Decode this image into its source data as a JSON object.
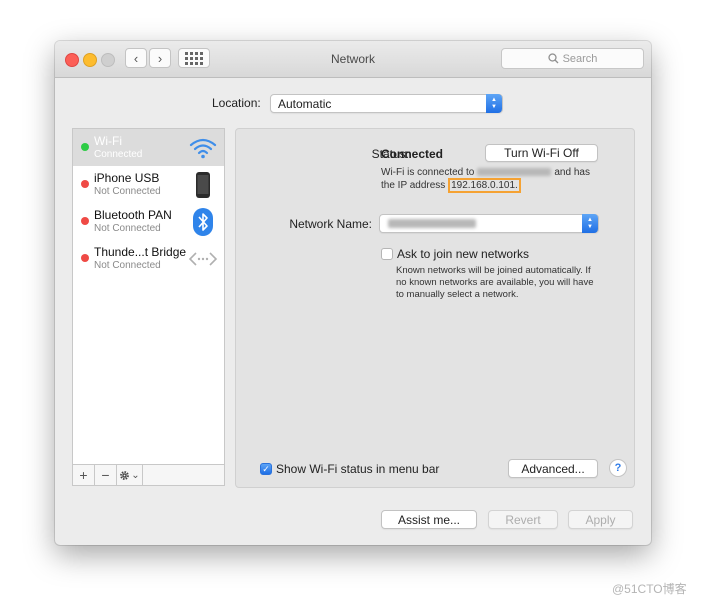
{
  "window": {
    "title": "Network",
    "search_placeholder": "Search",
    "back_glyph": "‹",
    "forward_glyph": "›"
  },
  "location": {
    "label": "Location:",
    "value": "Automatic"
  },
  "services": [
    {
      "name": "Wi-Fi",
      "status": "Connected",
      "status_color": "#2dcc45",
      "icon": "wifi-icon",
      "selected": true
    },
    {
      "name": "iPhone USB",
      "status": "Not Connected",
      "status_color": "#ef4a45",
      "icon": "iphone-icon",
      "selected": false
    },
    {
      "name": "Bluetooth PAN",
      "status": "Not Connected",
      "status_color": "#ef4a45",
      "icon": "bluetooth-icon",
      "selected": false
    },
    {
      "name": "Thunde...t Bridge",
      "status": "Not Connected",
      "status_color": "#ef4a45",
      "icon": "thunderbolt-bridge-icon",
      "selected": false
    }
  ],
  "sidebar_controls": {
    "add": "+",
    "remove": "−",
    "gear_caret": "⌄"
  },
  "detail": {
    "status_label": "Status:",
    "status_value": "Connected",
    "toggle_button": "Turn Wi-Fi Off",
    "info_line1_prefix": "Wi-Fi is connected to",
    "info_line1_suffix": "and has",
    "info_line2_prefix": "the IP address",
    "ip_address": "192.168.0.101.",
    "network_name_label": "Network Name:",
    "ask_join_label": "Ask to join new networks",
    "ask_join_checked": false,
    "ask_join_desc": [
      "Known networks will be joined automatically. If",
      "no known networks are available, you will have",
      "to manually select a network."
    ],
    "show_status_label": "Show Wi-Fi status in menu bar",
    "show_status_checked": true,
    "advanced_button": "Advanced...",
    "help_glyph": "?"
  },
  "footer": {
    "assist_button": "Assist me...",
    "revert_button": "Revert",
    "apply_button": "Apply"
  },
  "watermark": "@51CTO博客",
  "colors": {
    "accent_blue": "#2e7be8",
    "highlight_orange": "#f5a233",
    "connected_green": "#2dcc45",
    "disconnected_red": "#ef4a45"
  }
}
